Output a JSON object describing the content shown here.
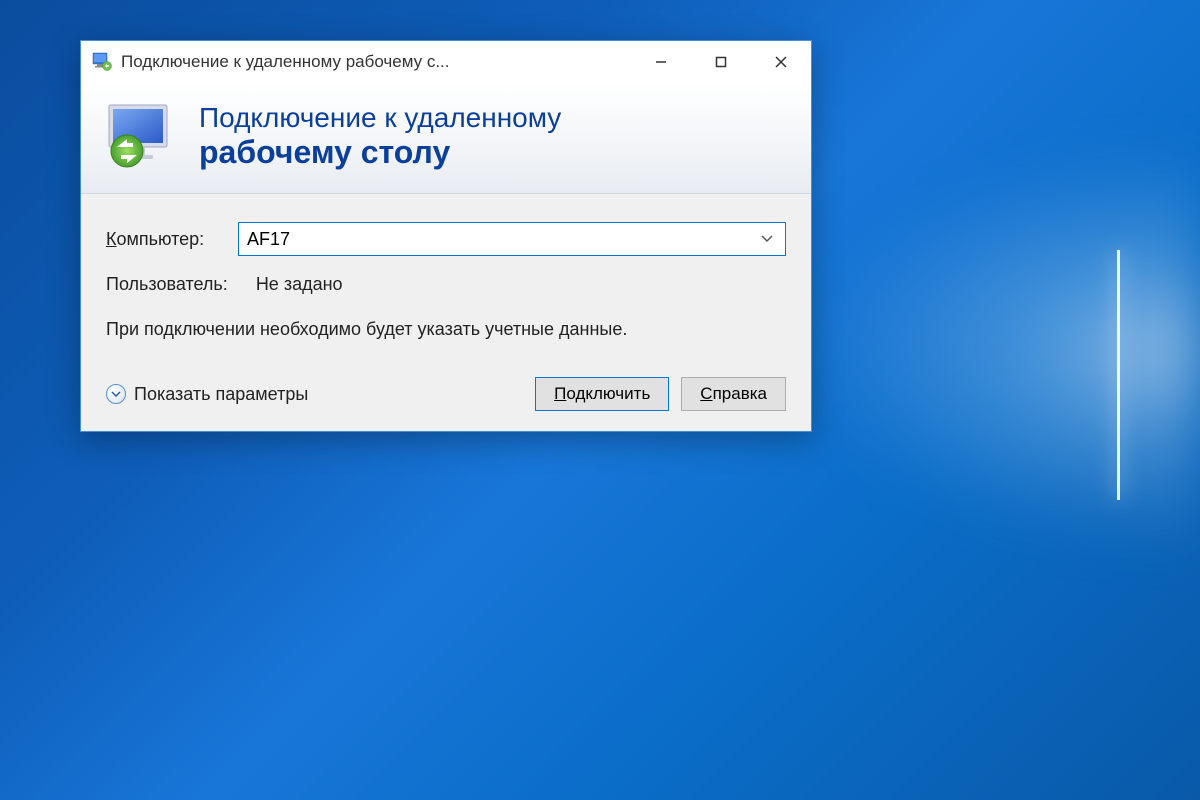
{
  "window": {
    "title": "Подключение к удаленному рабочему с..."
  },
  "header": {
    "line1": "Подключение к удаленному",
    "line2": "рабочему столу"
  },
  "form": {
    "computer_label_prefix": "К",
    "computer_label_rest": "омпьютер:",
    "computer_value": "AF17",
    "user_label": "Пользователь:",
    "user_value": "Не задано",
    "info_text": "При подключении необходимо будет указать учетные данные."
  },
  "footer": {
    "expand_label_prefix": "П",
    "expand_label_rest": "оказать параметры",
    "connect_prefix": "П",
    "connect_rest": "одключить",
    "help_prefix": "С",
    "help_rest": "правка"
  }
}
